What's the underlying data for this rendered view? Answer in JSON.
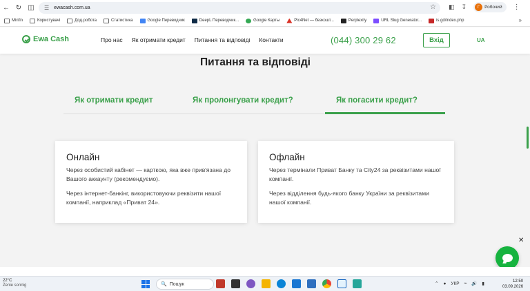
{
  "browser": {
    "url": "ewacash.com.ua",
    "profile_initial": "Г",
    "profile_name": "Робочий",
    "bookmarks": [
      "Minfin",
      "Користувачі",
      "Дод.робота",
      "Статистика",
      "Google Переводчик",
      "DeepL Переводчик...",
      "Google Карты",
      "Pic4Net — безкошт...",
      "Perplexity",
      "URL Slug Generator...",
      "is.gd/index.php"
    ]
  },
  "header": {
    "logo_text": "Ewa Cash",
    "nav": [
      "Про нас",
      "Як отримати кредит",
      "Питання та відповіді",
      "Контакти"
    ],
    "phone": "(044) 300 29 62",
    "login_label": "Вхід",
    "lang": "UA"
  },
  "faq": {
    "title": "Питання та відповіді",
    "tabs": [
      "Як отримати кредит",
      "Як пролонгувати кредит?",
      "Як погасити кредит?"
    ],
    "active_tab": "Як погасити кредит?",
    "cards": [
      {
        "title": "Онлайн",
        "paragraphs": [
          "Через особистий кабінет — карткою, яка вже прив'язана до Вашого аккаунту (рекомендуємо).",
          "Через інтернет-банкінг, використовуючи реквізити нашої компанії, наприклад «Приват 24»."
        ]
      },
      {
        "title": "Офлайн",
        "paragraphs": [
          "Через термінали Приват Банку та City24 за реквізитами нашої компанії.",
          "Через відділення будь-якого банку України за реквізитами нашої компанії."
        ]
      }
    ]
  },
  "colors": {
    "brand_green": "#3aa04a",
    "chat_green": "#16b33f"
  },
  "taskbar": {
    "temperature": "22°C",
    "weather": "Żenie sonnig",
    "search_placeholder": "Пошук",
    "lang": "УКР",
    "time": "12:50",
    "date": "03.09.2026"
  }
}
